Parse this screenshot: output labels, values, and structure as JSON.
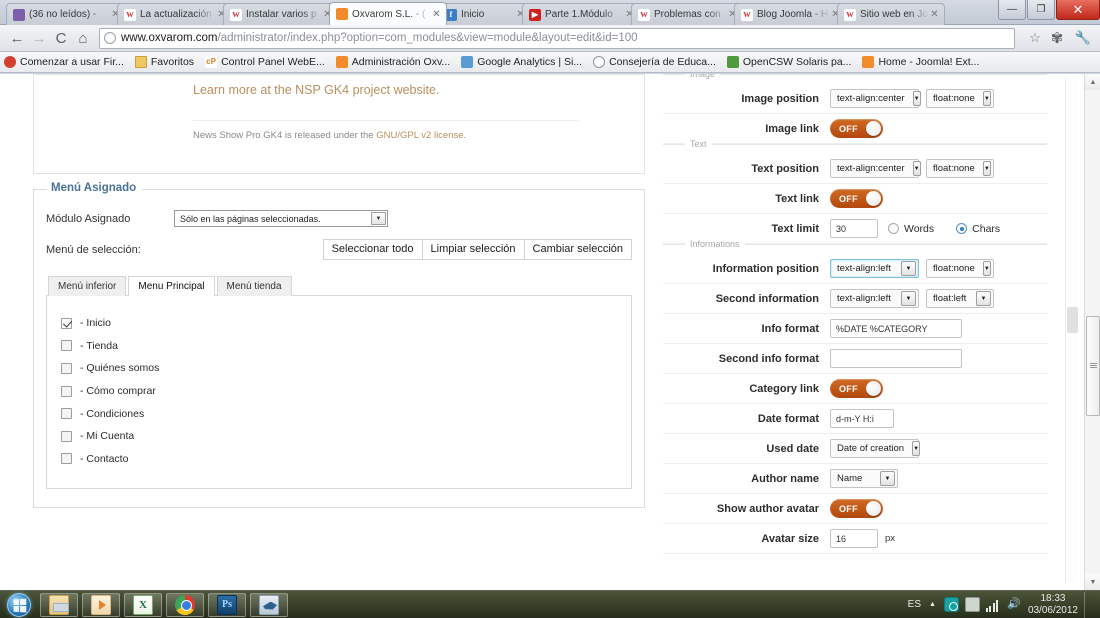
{
  "browser": {
    "tabs": [
      {
        "title": "(36 no leídos) - ",
        "favicon": "mail-icon",
        "active": false
      },
      {
        "title": "La actualización",
        "favicon": "wordpress-icon",
        "active": false
      },
      {
        "title": "Instalar varios p",
        "favicon": "wordpress-icon",
        "active": false
      },
      {
        "title": "Oxvarom S.L. - (",
        "favicon": "joomla-icon",
        "active": true
      },
      {
        "title": "Inicio",
        "favicon": "facebook-icon",
        "active": false
      },
      {
        "title": "Parte 1.Módulo",
        "favicon": "youtube-icon",
        "active": false
      },
      {
        "title": "Problemas con",
        "favicon": "wordpress-icon",
        "active": false
      },
      {
        "title": "Blog Joomla - H",
        "favicon": "wordpress-icon",
        "active": false
      },
      {
        "title": "Sitio web en Joo",
        "favicon": "wordpress-icon",
        "active": false
      }
    ],
    "window_controls": {
      "minimize": "—",
      "maximize": "❐",
      "close": "✕"
    },
    "nav": {
      "back": "←",
      "forward": "→",
      "reload": "C",
      "home": "⌂"
    },
    "url_domain": "www.oxvarom.com",
    "url_path": "/administrator/index.php?option=com_modules&view=module&layout=edit&id=100",
    "omnibox_star": "☆",
    "omnibox_gear": "✾",
    "omnibox_wrench": "🔧",
    "bookmarks": [
      {
        "label": "Comenzar a usar Fir...",
        "icon": "firefox-icon"
      },
      {
        "label": "Favoritos",
        "icon": "folder-icon"
      },
      {
        "label": "Control Panel WebE...",
        "icon": "cpanel-icon"
      },
      {
        "label": "Administración Oxv...",
        "icon": "joomla-icon"
      },
      {
        "label": "Google Analytics | Si...",
        "icon": "analytics-icon"
      },
      {
        "label": "Consejería de Educa...",
        "icon": "globe-icon"
      },
      {
        "label": "OpenCSW Solaris pa...",
        "icon": "opencsw-icon"
      },
      {
        "label": "Home - Joomla! Ext...",
        "icon": "joomla-icon"
      }
    ]
  },
  "page": {
    "top_panel": {
      "learn_more": "Learn more at the NSP GK4 project website.",
      "license_prefix": "News Show Pro GK4 is released under the ",
      "license_link": "GNU/GPL v2 license",
      "license_suffix": "."
    },
    "menu_assigned": {
      "legend": "Menú Asignado",
      "module_label": "Módulo Asignado",
      "module_value": "Sólo en las páginas seleccionadas.",
      "selection_label": "Menú de selección:",
      "buttons": [
        "Seleccionar todo",
        "Limpiar selección",
        "Cambiar selección"
      ],
      "tabs": [
        {
          "label": "Menú inferior",
          "active": false
        },
        {
          "label": "Menu Principal",
          "active": true
        },
        {
          "label": "Menú tienda",
          "active": false
        }
      ],
      "items": [
        {
          "label": "- Inicio",
          "checked": true
        },
        {
          "label": "- Tienda",
          "checked": false
        },
        {
          "label": "- Quiénes somos",
          "checked": false
        },
        {
          "label": "- Cómo comprar",
          "checked": false
        },
        {
          "label": "- Condiciones",
          "checked": false
        },
        {
          "label": "- Mi Cuenta",
          "checked": false
        },
        {
          "label": "- Contacto",
          "checked": false
        }
      ]
    },
    "right_panel": {
      "groups": [
        {
          "title": "Image",
          "rows": [
            {
              "label": "Image position",
              "type": "two-dropdown",
              "value1": "text-align:center",
              "value2": "float:none"
            },
            {
              "label": "Image link",
              "type": "toggle",
              "state": "OFF"
            }
          ]
        },
        {
          "title": "Text",
          "rows": [
            {
              "label": "Text position",
              "type": "two-dropdown",
              "value1": "text-align:center",
              "value2": "float:none"
            },
            {
              "label": "Text link",
              "type": "toggle",
              "state": "OFF"
            },
            {
              "label": "Text limit",
              "type": "limit",
              "value": "30",
              "option1": "Words",
              "option2": "Chars",
              "selected": "Chars"
            }
          ]
        },
        {
          "title": "Informations",
          "rows": [
            {
              "label": "Information position",
              "type": "two-dropdown",
              "value1": "text-align:left",
              "value2": "float:none",
              "focused": true
            },
            {
              "label": "Second information",
              "type": "two-dropdown",
              "value1": "text-align:left",
              "value2": "float:left"
            },
            {
              "label": "Info format",
              "type": "text",
              "value": "%DATE %CATEGORY"
            },
            {
              "label": "Second info format",
              "type": "text",
              "value": ""
            },
            {
              "label": "Category link",
              "type": "toggle",
              "state": "OFF"
            },
            {
              "label": "Date format",
              "type": "text",
              "value": "d-m-Y H:i"
            },
            {
              "label": "Used date",
              "type": "dropdown",
              "value": "Date of creation"
            },
            {
              "label": "Author name",
              "type": "dropdown",
              "value": "Name"
            },
            {
              "label": "Show author avatar",
              "type": "toggle",
              "state": "OFF"
            },
            {
              "label": "Avatar size",
              "type": "text-unit",
              "value": "16",
              "unit": "px"
            }
          ]
        }
      ]
    }
  },
  "taskbar": {
    "start": "start-orb",
    "apps": [
      {
        "name": "explorer-icon"
      },
      {
        "name": "media-player-icon"
      },
      {
        "name": "excel-icon"
      },
      {
        "name": "chrome-icon"
      },
      {
        "name": "photoshop-icon"
      },
      {
        "name": "bird-app-icon"
      }
    ],
    "tray": {
      "language": "ES",
      "show_hidden": "▲",
      "icons": [
        "sync-icon",
        "network-icon",
        "signal-icon",
        "volume-icon"
      ],
      "time": "18:33",
      "date": "03/06/2012"
    }
  },
  "colors": {
    "toggle_off": "#c25a15",
    "legend_blue": "#4a7297",
    "link_tan": "#b98f5e",
    "radio_blue": "#2f7ec0"
  }
}
